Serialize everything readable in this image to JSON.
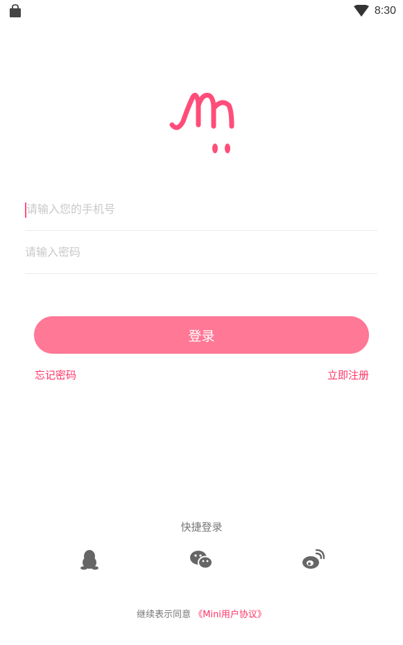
{
  "status_bar": {
    "time": "8:30",
    "icons": [
      "shopping-bag-icon",
      "wifi-icon"
    ]
  },
  "logo": {
    "icon": "mini-logo-icon",
    "color": "#ff4d7a"
  },
  "form": {
    "phone_placeholder": "请输入您的手机号",
    "password_placeholder": "请输入密码",
    "login_label": "登录",
    "forgot_label": "忘记密码",
    "register_label": "立即注册"
  },
  "quick_login": {
    "title": "快捷登录",
    "providers": [
      {
        "icon": "qq-icon"
      },
      {
        "icon": "wechat-icon"
      },
      {
        "icon": "weibo-icon"
      }
    ]
  },
  "agreement": {
    "prefix": "继续表示同意",
    "link_label": "《Mini用户协议》"
  },
  "colors": {
    "accent": "#ff3366",
    "button": "#ff7896",
    "placeholder": "#c8c8c8",
    "icon_gray": "#666666"
  }
}
